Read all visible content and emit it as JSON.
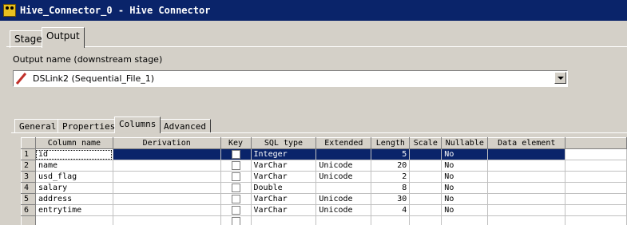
{
  "window": {
    "title": "Hive_Connector_0 - Hive Connector"
  },
  "outer_tabs": [
    {
      "label": "Stage"
    },
    {
      "label": "Output"
    }
  ],
  "output": {
    "name_label": "Output name (downstream stage)",
    "selected_value": "DSLink2 (Sequential_File_1)"
  },
  "inner_tabs": [
    {
      "label": "General"
    },
    {
      "label": "Properties"
    },
    {
      "label": "Columns"
    },
    {
      "label": "Advanced"
    }
  ],
  "grid": {
    "headers": [
      "Column name",
      "Derivation",
      "Key",
      "SQL type",
      "Extended",
      "Length",
      "Scale",
      "Nullable",
      "Data element"
    ],
    "rows": [
      {
        "num": "1",
        "name": "id",
        "derivation": "",
        "key": false,
        "sql_type": "Integer",
        "extended": "",
        "length": "5",
        "scale": "",
        "nullable": "No",
        "data_element": ""
      },
      {
        "num": "2",
        "name": "name",
        "derivation": "",
        "key": false,
        "sql_type": "VarChar",
        "extended": "Unicode",
        "length": "20",
        "scale": "",
        "nullable": "No",
        "data_element": ""
      },
      {
        "num": "3",
        "name": "usd_flag",
        "derivation": "",
        "key": false,
        "sql_type": "VarChar",
        "extended": "Unicode",
        "length": "2",
        "scale": "",
        "nullable": "No",
        "data_element": ""
      },
      {
        "num": "4",
        "name": "salary",
        "derivation": "",
        "key": false,
        "sql_type": "Double",
        "extended": "",
        "length": "8",
        "scale": "",
        "nullable": "No",
        "data_element": ""
      },
      {
        "num": "5",
        "name": "address",
        "derivation": "",
        "key": false,
        "sql_type": "VarChar",
        "extended": "Unicode",
        "length": "30",
        "scale": "",
        "nullable": "No",
        "data_element": ""
      },
      {
        "num": "6",
        "name": "entrytime",
        "derivation": "",
        "key": false,
        "sql_type": "VarChar",
        "extended": "Unicode",
        "length": "4",
        "scale": "",
        "nullable": "No",
        "data_element": ""
      }
    ]
  }
}
